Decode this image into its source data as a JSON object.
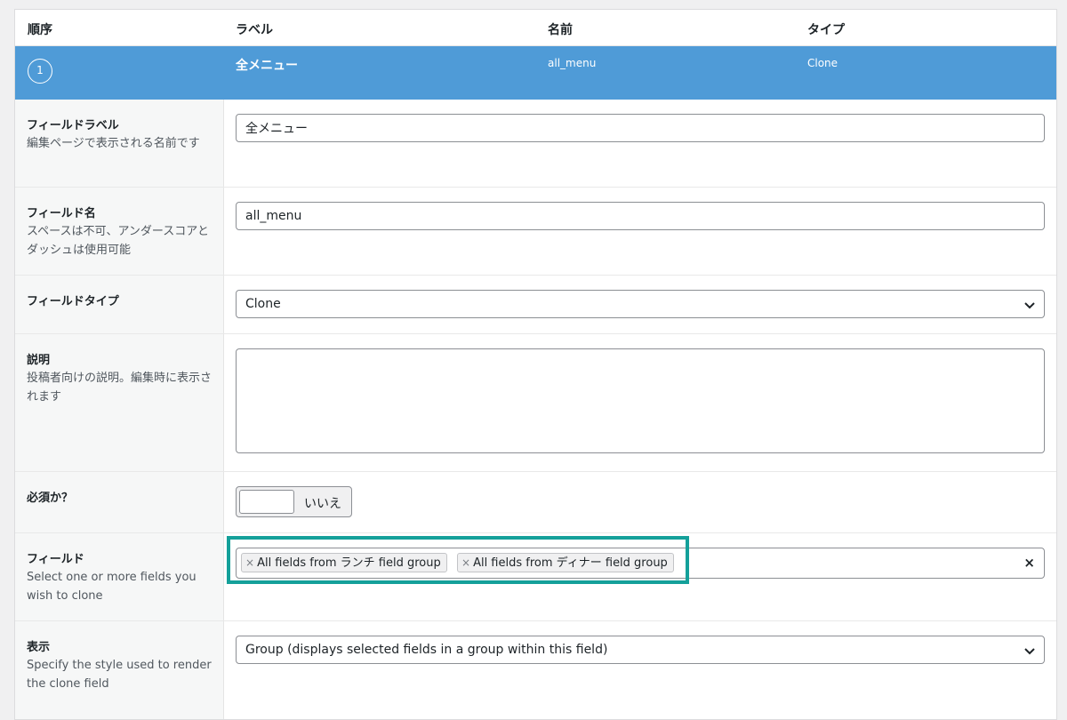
{
  "table_header": {
    "order": "順序",
    "label": "ラベル",
    "name": "名前",
    "type": "タイプ"
  },
  "field_row": {
    "order_number": "1",
    "label": "全メニュー",
    "name": "all_menu",
    "type": "Clone"
  },
  "settings": {
    "field_label": {
      "title": "フィールドラベル",
      "description": "編集ページで表示される名前です",
      "value": "全メニュー"
    },
    "field_name": {
      "title": "フィールド名",
      "description": "スペースは不可、アンダースコアとダッシュは使用可能",
      "value": "all_menu"
    },
    "field_type": {
      "title": "フィールドタイプ",
      "selected": "Clone"
    },
    "instructions": {
      "title": "説明",
      "description": "投稿者向けの説明。編集時に表示されます",
      "value": ""
    },
    "required": {
      "title": "必須か？",
      "toggle_text": "いいえ"
    },
    "fields": {
      "title": "フィールド",
      "description": "Select one or more fields you wish to clone",
      "tags": [
        "All fields from ランチ field group",
        "All fields from ディナー field group"
      ],
      "tag_remove_glyph": "×",
      "clear_glyph": "×"
    },
    "display": {
      "title": "表示",
      "description": "Specify the style used to render the clone field",
      "selected": "Group (displays selected fields in a group within this field)"
    }
  },
  "colors": {
    "accent_row": "#4f9bd7",
    "highlight_box": "#14a09a"
  },
  "icons": {
    "select_arrow": "chevron-down-icon",
    "remove": "close-icon"
  }
}
